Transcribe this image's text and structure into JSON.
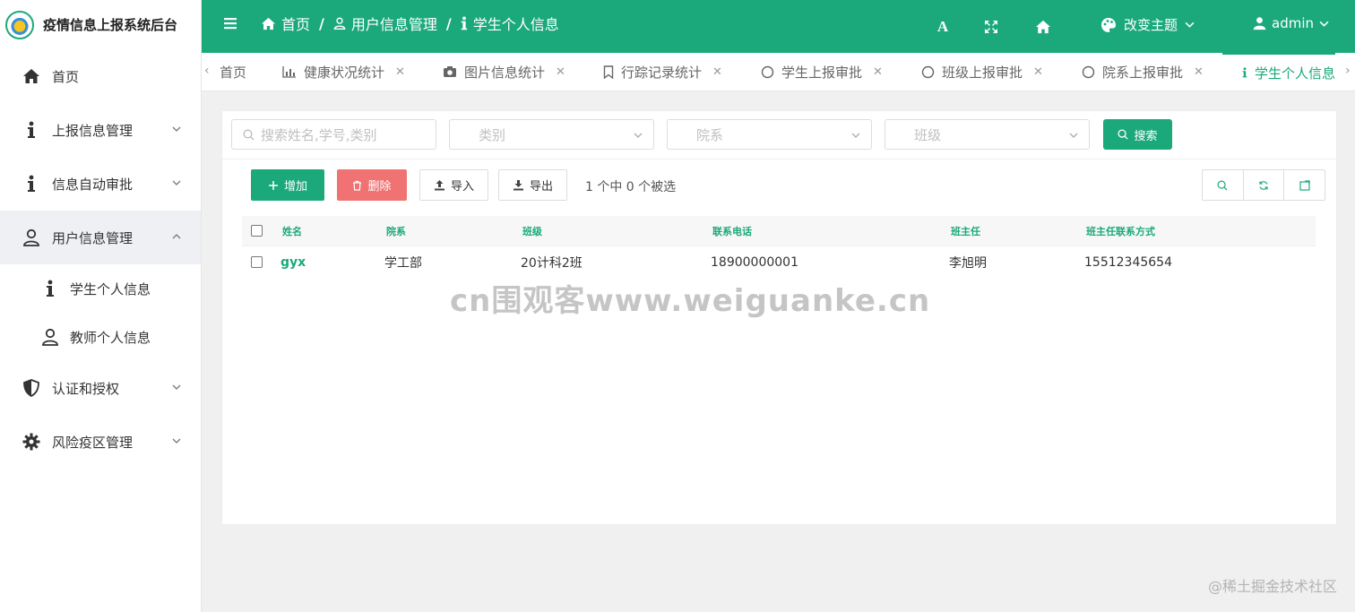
{
  "brand": {
    "title": "疫情信息上报系统后台"
  },
  "sidebar": {
    "items": [
      {
        "label": "首页"
      },
      {
        "label": "上报信息管理"
      },
      {
        "label": "信息自动审批"
      },
      {
        "label": "用户信息管理"
      },
      {
        "label": "认证和授权"
      },
      {
        "label": "风险疫区管理"
      }
    ],
    "sub_items": [
      {
        "label": "学生个人信息"
      },
      {
        "label": "教师个人信息"
      }
    ]
  },
  "header": {
    "breadcrumbs": [
      "首页",
      "用户信息管理",
      "学生个人信息"
    ],
    "font_button": "A",
    "theme_label": "改变主题",
    "user_name": "admin",
    "bg_color": "#1ba97b"
  },
  "tabs": [
    {
      "label": "首页"
    },
    {
      "label": "健康状况统计"
    },
    {
      "label": "图片信息统计"
    },
    {
      "label": "行踪记录统计"
    },
    {
      "label": "学生上报审批"
    },
    {
      "label": "班级上报审批"
    },
    {
      "label": "院系上报审批"
    },
    {
      "label": "学生个人信息"
    }
  ],
  "search": {
    "keyword_placeholder": "搜索姓名,学号,类别",
    "category_placeholder": "类别",
    "department_placeholder": "院系",
    "class_placeholder": "班级",
    "search_label": "搜索"
  },
  "toolbar": {
    "add_label": "增加",
    "delete_label": "删除",
    "import_label": "导入",
    "export_label": "导出",
    "selection_info": "1 个中 0 个被选"
  },
  "table": {
    "headers": [
      "姓名",
      "院系",
      "班级",
      "联系电话",
      "班主任",
      "班主任联系方式"
    ],
    "rows": [
      [
        "gyx",
        "学工部",
        "20计科2班",
        "18900000001",
        "李旭明",
        "15512345654"
      ]
    ]
  },
  "watermark": "cn围观客www.weiguanke.cn",
  "footer_watermark": "@稀土掘金技术社区"
}
